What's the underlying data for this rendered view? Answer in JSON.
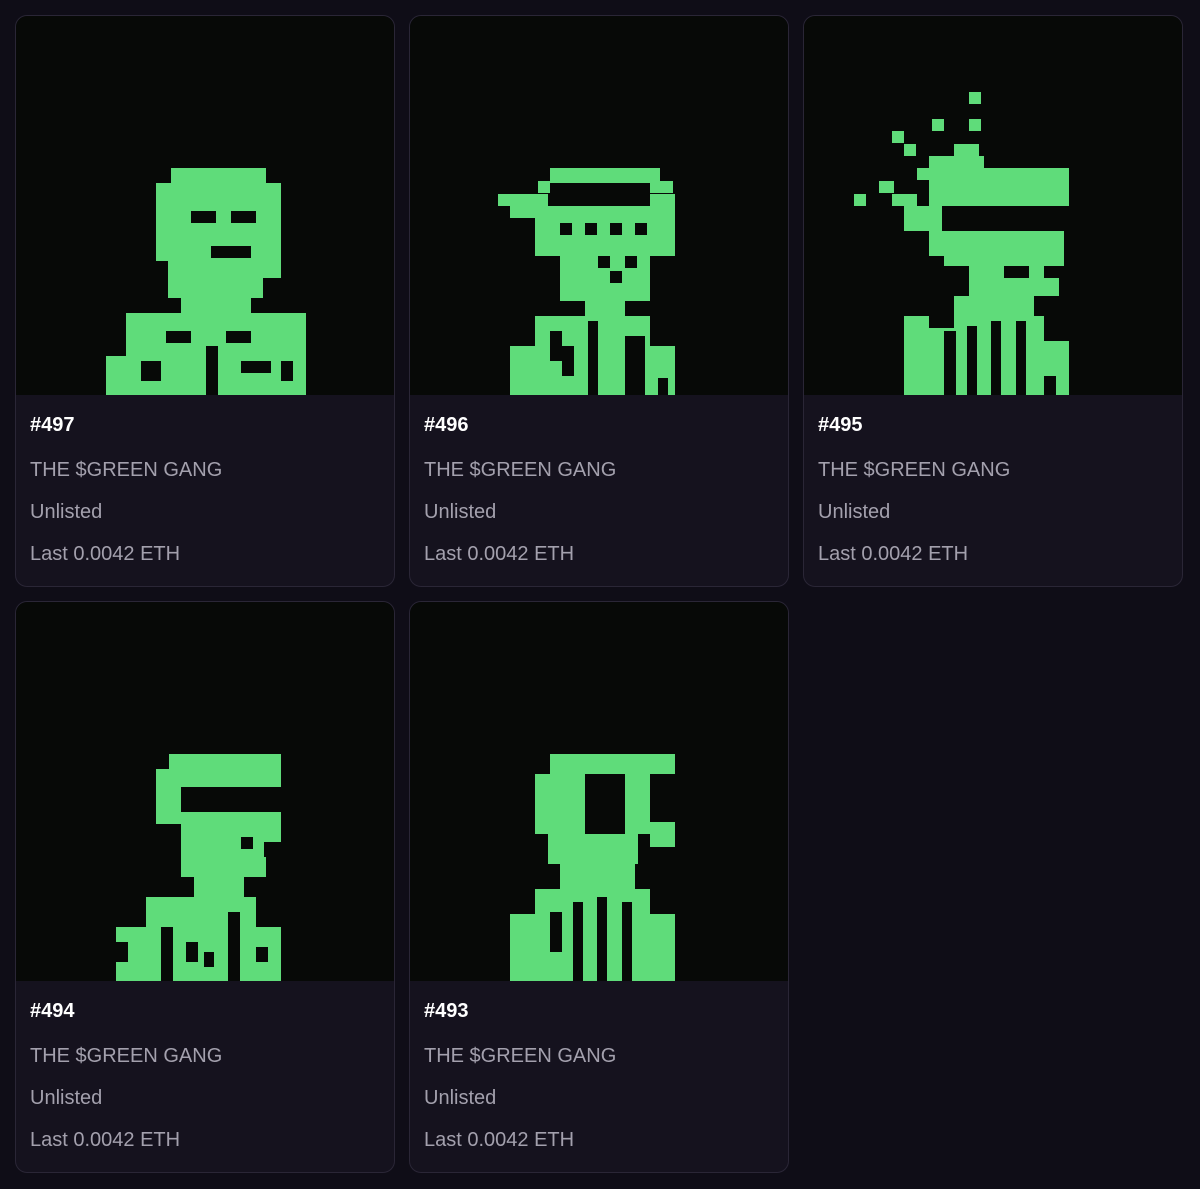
{
  "theme": {
    "background": "#0f0d17",
    "card_background": "#15121e",
    "card_border": "#2a2636",
    "art_background": "#070907",
    "pixel_green": "#5fdc7a"
  },
  "cards": [
    {
      "id": "#497",
      "collection": "THE $GREEN GANG",
      "status": "Unlisted",
      "last_price": "Last 0.0042 ETH"
    },
    {
      "id": "#496",
      "collection": "THE $GREEN GANG",
      "status": "Unlisted",
      "last_price": "Last 0.0042 ETH"
    },
    {
      "id": "#495",
      "collection": "THE $GREEN GANG",
      "status": "Unlisted",
      "last_price": "Last 0.0042 ETH"
    },
    {
      "id": "#494",
      "collection": "THE $GREEN GANG",
      "status": "Unlisted",
      "last_price": "Last 0.0042 ETH"
    },
    {
      "id": "#493",
      "collection": "THE $GREEN GANG",
      "status": "Unlisted",
      "last_price": "Last 0.0042 ETH"
    }
  ]
}
